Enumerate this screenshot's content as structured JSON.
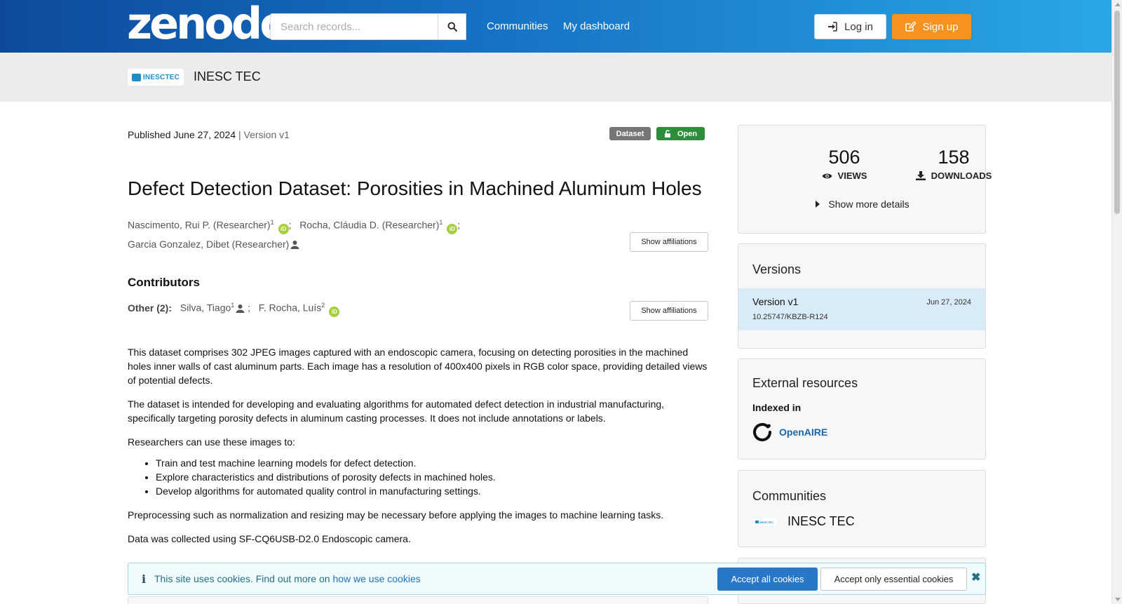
{
  "header": {
    "logo_text": "zenodo",
    "search_placeholder": "Search records...",
    "nav": [
      "Communities",
      "My dashboard"
    ],
    "login_label": "Log in",
    "signup_label": "Sign up"
  },
  "community_bar": {
    "logo_text": "INESCTEC",
    "name": "INESC TEC"
  },
  "record": {
    "published": "Published June 27, 2024",
    "version": "| Version v1",
    "type_badge": "Dataset",
    "access_badge": "Open",
    "title": "Defect Detection Dataset: Porosities in Machined Aluminum Holes",
    "creators": [
      {
        "name": "Nascimento, Rui P. (Researcher)",
        "sup": "1",
        "orcid": true
      },
      {
        "name": "Rocha, Cláudia D. (Researcher)",
        "sup": "1",
        "orcid": true
      },
      {
        "name": "Garcia Gonzalez, Dibet (Researcher)",
        "sup": "",
        "orcid": false
      }
    ],
    "show_affiliations": "Show affiliations",
    "contributors_heading": "Contributors",
    "contributors_role": "Other (2):",
    "contributors": [
      {
        "name": "Silva, Tiago",
        "sup": "1",
        "orcid": false
      },
      {
        "name": "F. Rocha, Luís",
        "sup": "2",
        "orcid": true
      }
    ],
    "orcid_label": "iD",
    "description": {
      "p1": "This dataset comprises 302 JPEG images captured with an endoscopic camera, focusing on detecting porosities in the machined holes inner walls of cast aluminum parts. Each image has a resolution of 400x400 pixels in RGB color space, providing detailed views of potential defects.",
      "p2": "The dataset is intended for developing and evaluating algorithms for automated defect detection in industrial manufacturing, specifically targeting porosity defects in aluminum casting processes. It does not include annotations or labels.",
      "p3": "Researchers can use these images to:",
      "bullets": [
        "Train and test machine learning models for defect detection.",
        "Explore characteristics and distributions of porosity defects in machined holes.",
        "Develop algorithms for automated quality control in manufacturing settings."
      ],
      "p4": "Preprocessing such as normalization and resizing may be necessary before applying the images to machine learning tasks.",
      "p5": "Data was collected using SF-CQ6USB-D2.0 Endoscopic camera."
    }
  },
  "sidebar": {
    "views_value": "506",
    "views_label": "VIEWS",
    "downloads_value": "158",
    "downloads_label": "DOWNLOADS",
    "show_more": "Show more details",
    "versions_title": "Versions",
    "version_name": "Version v1",
    "version_date": "Jun 27, 2024",
    "version_doi": "10.25747/KBZB-R124",
    "external_title": "External resources",
    "indexed_in": "Indexed in",
    "openaire": "OpenAIRE",
    "communities_title": "Communities",
    "community_name": "INESC TEC",
    "community_logo_text": "INESCTEC"
  },
  "cookie": {
    "text": "This site uses cookies. Find out more on ",
    "link": "how we use cookies",
    "accept_all": "Accept all cookies",
    "accept_essential": "Accept only essential cookies"
  },
  "colors": {
    "header_start": "#0d4a9c",
    "header_end": "#2aa6e6",
    "signup": "#f5931e",
    "open_badge": "#2c8e3a",
    "link": "#1e70bf",
    "orcid": "#a6ce39"
  }
}
